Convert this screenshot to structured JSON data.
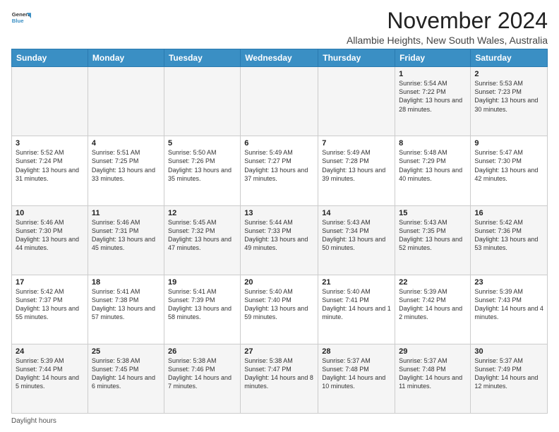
{
  "header": {
    "logo_line1": "General",
    "logo_line2": "Blue",
    "main_title": "November 2024",
    "subtitle": "Allambie Heights, New South Wales, Australia"
  },
  "days_of_week": [
    "Sunday",
    "Monday",
    "Tuesday",
    "Wednesday",
    "Thursday",
    "Friday",
    "Saturday"
  ],
  "weeks": [
    [
      {
        "num": "",
        "info": ""
      },
      {
        "num": "",
        "info": ""
      },
      {
        "num": "",
        "info": ""
      },
      {
        "num": "",
        "info": ""
      },
      {
        "num": "",
        "info": ""
      },
      {
        "num": "1",
        "info": "Sunrise: 5:54 AM\nSunset: 7:22 PM\nDaylight: 13 hours and 28 minutes."
      },
      {
        "num": "2",
        "info": "Sunrise: 5:53 AM\nSunset: 7:23 PM\nDaylight: 13 hours and 30 minutes."
      }
    ],
    [
      {
        "num": "3",
        "info": "Sunrise: 5:52 AM\nSunset: 7:24 PM\nDaylight: 13 hours and 31 minutes."
      },
      {
        "num": "4",
        "info": "Sunrise: 5:51 AM\nSunset: 7:25 PM\nDaylight: 13 hours and 33 minutes."
      },
      {
        "num": "5",
        "info": "Sunrise: 5:50 AM\nSunset: 7:26 PM\nDaylight: 13 hours and 35 minutes."
      },
      {
        "num": "6",
        "info": "Sunrise: 5:49 AM\nSunset: 7:27 PM\nDaylight: 13 hours and 37 minutes."
      },
      {
        "num": "7",
        "info": "Sunrise: 5:49 AM\nSunset: 7:28 PM\nDaylight: 13 hours and 39 minutes."
      },
      {
        "num": "8",
        "info": "Sunrise: 5:48 AM\nSunset: 7:29 PM\nDaylight: 13 hours and 40 minutes."
      },
      {
        "num": "9",
        "info": "Sunrise: 5:47 AM\nSunset: 7:30 PM\nDaylight: 13 hours and 42 minutes."
      }
    ],
    [
      {
        "num": "10",
        "info": "Sunrise: 5:46 AM\nSunset: 7:30 PM\nDaylight: 13 hours and 44 minutes."
      },
      {
        "num": "11",
        "info": "Sunrise: 5:46 AM\nSunset: 7:31 PM\nDaylight: 13 hours and 45 minutes."
      },
      {
        "num": "12",
        "info": "Sunrise: 5:45 AM\nSunset: 7:32 PM\nDaylight: 13 hours and 47 minutes."
      },
      {
        "num": "13",
        "info": "Sunrise: 5:44 AM\nSunset: 7:33 PM\nDaylight: 13 hours and 49 minutes."
      },
      {
        "num": "14",
        "info": "Sunrise: 5:43 AM\nSunset: 7:34 PM\nDaylight: 13 hours and 50 minutes."
      },
      {
        "num": "15",
        "info": "Sunrise: 5:43 AM\nSunset: 7:35 PM\nDaylight: 13 hours and 52 minutes."
      },
      {
        "num": "16",
        "info": "Sunrise: 5:42 AM\nSunset: 7:36 PM\nDaylight: 13 hours and 53 minutes."
      }
    ],
    [
      {
        "num": "17",
        "info": "Sunrise: 5:42 AM\nSunset: 7:37 PM\nDaylight: 13 hours and 55 minutes."
      },
      {
        "num": "18",
        "info": "Sunrise: 5:41 AM\nSunset: 7:38 PM\nDaylight: 13 hours and 57 minutes."
      },
      {
        "num": "19",
        "info": "Sunrise: 5:41 AM\nSunset: 7:39 PM\nDaylight: 13 hours and 58 minutes."
      },
      {
        "num": "20",
        "info": "Sunrise: 5:40 AM\nSunset: 7:40 PM\nDaylight: 13 hours and 59 minutes."
      },
      {
        "num": "21",
        "info": "Sunrise: 5:40 AM\nSunset: 7:41 PM\nDaylight: 14 hours and 1 minute."
      },
      {
        "num": "22",
        "info": "Sunrise: 5:39 AM\nSunset: 7:42 PM\nDaylight: 14 hours and 2 minutes."
      },
      {
        "num": "23",
        "info": "Sunrise: 5:39 AM\nSunset: 7:43 PM\nDaylight: 14 hours and 4 minutes."
      }
    ],
    [
      {
        "num": "24",
        "info": "Sunrise: 5:39 AM\nSunset: 7:44 PM\nDaylight: 14 hours and 5 minutes."
      },
      {
        "num": "25",
        "info": "Sunrise: 5:38 AM\nSunset: 7:45 PM\nDaylight: 14 hours and 6 minutes."
      },
      {
        "num": "26",
        "info": "Sunrise: 5:38 AM\nSunset: 7:46 PM\nDaylight: 14 hours and 7 minutes."
      },
      {
        "num": "27",
        "info": "Sunrise: 5:38 AM\nSunset: 7:47 PM\nDaylight: 14 hours and 8 minutes."
      },
      {
        "num": "28",
        "info": "Sunrise: 5:37 AM\nSunset: 7:48 PM\nDaylight: 14 hours and 10 minutes."
      },
      {
        "num": "29",
        "info": "Sunrise: 5:37 AM\nSunset: 7:48 PM\nDaylight: 14 hours and 11 minutes."
      },
      {
        "num": "30",
        "info": "Sunrise: 5:37 AM\nSunset: 7:49 PM\nDaylight: 14 hours and 12 minutes."
      }
    ]
  ],
  "footer": {
    "daylight_label": "Daylight hours"
  }
}
